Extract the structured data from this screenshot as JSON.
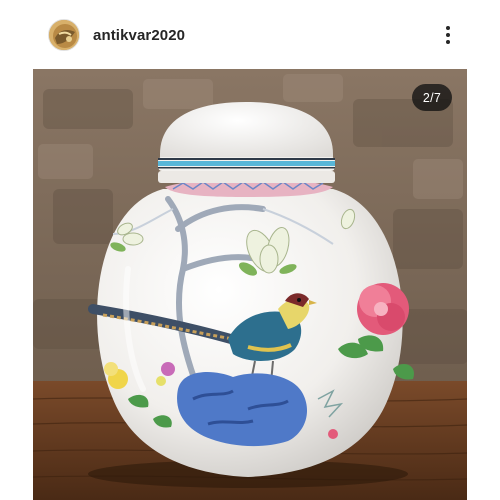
{
  "post": {
    "username": "antikvar2020",
    "more_icon": "more-vertical-icon",
    "avatar_icon": "avatar-image"
  },
  "media": {
    "counter": "2/7",
    "description": "",
    "colors": {
      "background_wall": "#7d6a58",
      "table_wood": "#6a4225",
      "porcelain": "#f4f3f1",
      "lid_band": "#58b6d8",
      "peony": "#e35a7a",
      "rock": "#4f79c8"
    }
  }
}
